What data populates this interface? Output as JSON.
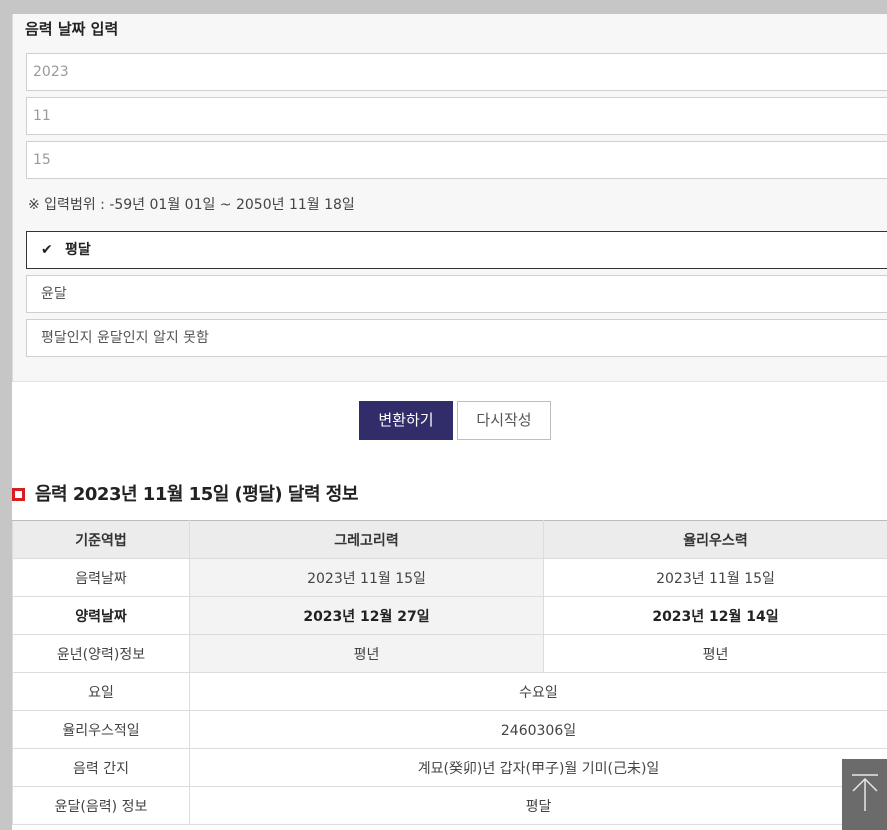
{
  "form": {
    "title": "음력 날짜 입력",
    "year_value": "2023",
    "month_value": "11",
    "day_value": "15",
    "range_note": "※ 입력범위 : -59년 01월 01일 ~ 2050년 11월 18일",
    "options": [
      {
        "label": "평달",
        "selected": true
      },
      {
        "label": "윤달",
        "selected": false
      },
      {
        "label": "평달인지 윤달인지 알지 못함",
        "selected": false
      }
    ],
    "check_glyph": "✔"
  },
  "buttons": {
    "convert": "변환하기",
    "reset": "다시작성"
  },
  "result": {
    "title": "음력 2023년 11월 15일 (평달) 달력 정보",
    "headers": [
      "기준역법",
      "그레고리력",
      "율리우스력"
    ],
    "rows": [
      {
        "label": "음력날짜",
        "greg": "2023년 11월 15일",
        "jul": "2023년 11월 15일"
      },
      {
        "label": "양력날짜",
        "greg": "2023년 12월 27일",
        "jul": "2023년 12월 14일"
      },
      {
        "label": "윤년(양력)정보",
        "greg": "평년",
        "jul": "평년"
      }
    ],
    "merged_rows": [
      {
        "label": "요일",
        "value": "수요일"
      },
      {
        "label": "율리우스적일",
        "value": "2460306일"
      },
      {
        "label": "음력 간지",
        "value": "계묘(癸卯)년 갑자(甲子)월 기미(己未)일"
      },
      {
        "label": "윤달(음력) 정보",
        "value": "평달"
      }
    ]
  },
  "colors": {
    "primary_button": "#312c6a",
    "section_marker": "#d71f1f"
  },
  "icons": {
    "scroll_top": "arrow-up-icon"
  }
}
